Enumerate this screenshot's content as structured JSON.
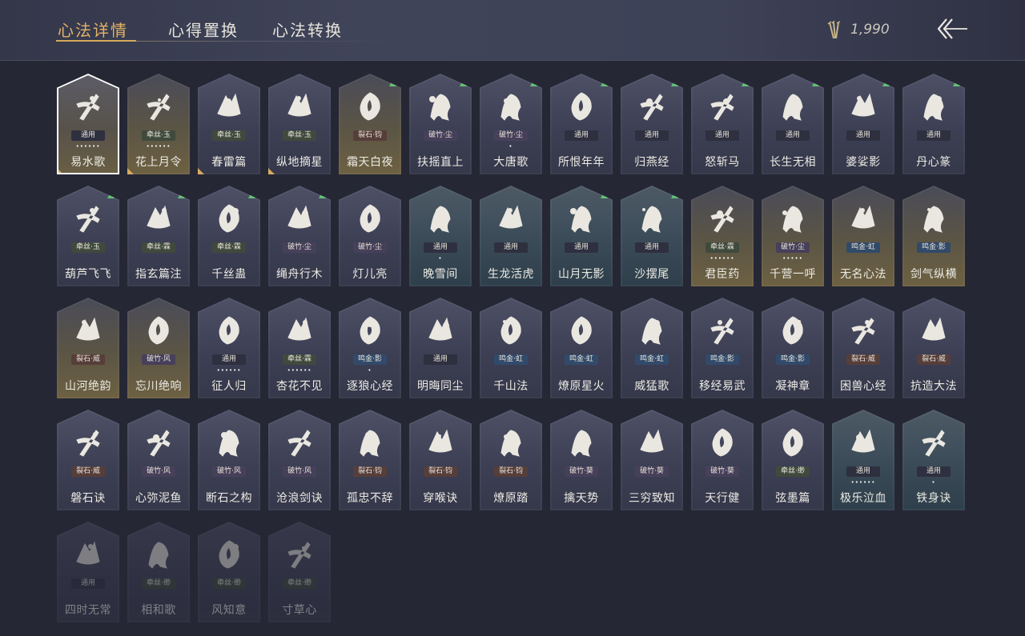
{
  "header": {
    "tabs": [
      {
        "label": "心法详情",
        "active": true
      },
      {
        "label": "心得置换",
        "active": false
      },
      {
        "label": "心法转换",
        "active": false
      }
    ],
    "currency": {
      "icon": "arrow-bundle-icon",
      "amount": "1,990"
    },
    "back_icon": "back-arrow-icon"
  },
  "colors": {
    "accent": "#e3b367",
    "upgrade_arrow": "#5fbf73",
    "background": "#262735"
  },
  "cards": [
    {
      "name": "易水歌",
      "tag": "通用",
      "tag_kind": "tongyong",
      "dots": "••••••",
      "arrow": false,
      "style": "selected",
      "icon": "horse-icon",
      "corner": true
    },
    {
      "name": "花上月令",
      "tag": "牵丝·玉",
      "tag_kind": "jinsi",
      "dots": "••••••",
      "arrow": false,
      "style": "gold",
      "icon": "flower-moon-icon",
      "corner": true
    },
    {
      "name": "春雷篇",
      "tag": "牵丝·玉",
      "tag_kind": "jinsi",
      "dots": "",
      "arrow": false,
      "style": "default",
      "icon": "thunder-tree-icon",
      "corner": true
    },
    {
      "name": "纵地摘星",
      "tag": "牵丝·玉",
      "tag_kind": "jinsi",
      "dots": "",
      "arrow": false,
      "style": "default",
      "icon": "star-grab-icon",
      "corner": true
    },
    {
      "name": "霜天白夜",
      "tag": "裂石·钧",
      "tag_kind": "jushi",
      "dots": "",
      "arrow": true,
      "style": "gold",
      "icon": "blade-icon",
      "corner": false
    },
    {
      "name": "扶摇直上",
      "tag": "破竹·尘",
      "tag_kind": "paozhu",
      "dots": "",
      "arrow": true,
      "style": "default",
      "icon": "eagle-icon",
      "corner": false
    },
    {
      "name": "大唐歌",
      "tag": "破竹·尘",
      "tag_kind": "paozhu",
      "dots": "•",
      "arrow": true,
      "style": "default",
      "icon": "palace-icon",
      "corner": false
    },
    {
      "name": "所恨年年",
      "tag": "通用",
      "tag_kind": "tongyong",
      "dots": "",
      "arrow": true,
      "style": "default",
      "icon": "ink-drop-icon",
      "corner": false
    },
    {
      "name": "归燕经",
      "tag": "通用",
      "tag_kind": "tongyong",
      "dots": "",
      "arrow": true,
      "style": "default",
      "icon": "swallow-icon",
      "corner": false
    },
    {
      "name": "怒斩马",
      "tag": "通用",
      "tag_kind": "tongyong",
      "dots": "",
      "arrow": true,
      "style": "default",
      "icon": "sabre-icon",
      "corner": false
    },
    {
      "name": "长生无相",
      "tag": "通用",
      "tag_kind": "tongyong",
      "dots": "",
      "arrow": true,
      "style": "default",
      "icon": "statue-icon",
      "corner": false
    },
    {
      "name": "婆娑影",
      "tag": "通用",
      "tag_kind": "tongyong",
      "dots": "",
      "arrow": true,
      "style": "default",
      "icon": "dragon-icon",
      "corner": false
    },
    {
      "name": "丹心篆",
      "tag": "通用",
      "tag_kind": "tongyong",
      "dots": "",
      "arrow": true,
      "style": "default",
      "icon": "fish-icon",
      "corner": false
    },
    {
      "name": "葫芦飞飞",
      "tag": "牵丝·玉",
      "tag_kind": "jinsi",
      "dots": "",
      "arrow": true,
      "style": "default",
      "icon": "gourd-icon",
      "corner": false
    },
    {
      "name": "指玄篇注",
      "tag": "牵丝·霖",
      "tag_kind": "jinsi",
      "dots": "",
      "arrow": true,
      "style": "default",
      "icon": "yinyang-icon",
      "corner": false
    },
    {
      "name": "千丝蛊",
      "tag": "牵丝·霖",
      "tag_kind": "jinsi",
      "dots": "",
      "arrow": true,
      "style": "default",
      "icon": "leaf-icon",
      "corner": false
    },
    {
      "name": "绳舟行木",
      "tag": "破竹·尘",
      "tag_kind": "paozhu",
      "dots": "",
      "arrow": true,
      "style": "default",
      "icon": "roots-icon",
      "corner": false
    },
    {
      "name": "灯儿亮",
      "tag": "破竹·尘",
      "tag_kind": "paozhu",
      "dots": "",
      "arrow": false,
      "style": "default",
      "icon": "lantern-icon",
      "corner": false
    },
    {
      "name": "晚雪间",
      "tag": "通用",
      "tag_kind": "tongyong",
      "dots": "•",
      "arrow": false,
      "style": "teal",
      "icon": "sword-cross-icon",
      "corner": false
    },
    {
      "name": "生龙活虎",
      "tag": "通用",
      "tag_kind": "tongyong",
      "dots": "",
      "arrow": false,
      "style": "teal",
      "icon": "tiger-icon",
      "corner": false
    },
    {
      "name": "山月无影",
      "tag": "通用",
      "tag_kind": "tongyong",
      "dots": "",
      "arrow": true,
      "style": "teal",
      "icon": "moon-blade-icon",
      "corner": false
    },
    {
      "name": "沙摆尾",
      "tag": "通用",
      "tag_kind": "tongyong",
      "dots": "",
      "arrow": true,
      "style": "teal",
      "icon": "whirl-icon",
      "corner": false
    },
    {
      "name": "君臣药",
      "tag": "牵丝·霖",
      "tag_kind": "jinsi",
      "dots": "••••••",
      "arrow": false,
      "style": "gold",
      "icon": "herb-icon",
      "corner": false
    },
    {
      "name": "千营一呼",
      "tag": "破竹·尘",
      "tag_kind": "paozhu",
      "dots": "•••••",
      "arrow": false,
      "style": "gold",
      "icon": "flag-icon",
      "corner": false
    },
    {
      "name": "无名心法",
      "tag": "鸣金·虹",
      "tag_kind": "mingjin",
      "dots": "",
      "arrow": false,
      "style": "gold",
      "icon": "spear-icon",
      "corner": false
    },
    {
      "name": "剑气纵横",
      "tag": "鸣金·影",
      "tag_kind": "mingjin",
      "dots": "",
      "arrow": false,
      "style": "gold",
      "icon": "crossed-swords-icon",
      "corner": false
    },
    {
      "name": "山河绝韵",
      "tag": "裂石·威",
      "tag_kind": "jushi",
      "dots": "",
      "arrow": false,
      "style": "gold",
      "icon": "mountain-icon",
      "corner": false
    },
    {
      "name": "忘川绝响",
      "tag": "破竹·风",
      "tag_kind": "paozhu",
      "dots": "",
      "arrow": false,
      "style": "gold",
      "icon": "mask-icon",
      "corner": false
    },
    {
      "name": "征人归",
      "tag": "通用",
      "tag_kind": "tongyong",
      "dots": "••••••",
      "arrow": false,
      "style": "default",
      "icon": "raven-hand-icon",
      "corner": false
    },
    {
      "name": "杏花不见",
      "tag": "牵丝·霖",
      "tag_kind": "jinsi",
      "dots": "••••••",
      "arrow": false,
      "style": "default",
      "icon": "blossom-icon",
      "corner": false
    },
    {
      "name": "逐狼心经",
      "tag": "鸣金·影",
      "tag_kind": "mingjin",
      "dots": "•",
      "arrow": false,
      "style": "default",
      "icon": "wolf-icon",
      "corner": false
    },
    {
      "name": "明晦同尘",
      "tag": "通用",
      "tag_kind": "tongyong",
      "dots": "",
      "arrow": false,
      "style": "default",
      "icon": "snake-staff-icon",
      "corner": false
    },
    {
      "name": "千山法",
      "tag": "鸣金·虹",
      "tag_kind": "mingjin",
      "dots": "",
      "arrow": false,
      "style": "default",
      "icon": "peaks-icon",
      "corner": false
    },
    {
      "name": "燎原星火",
      "tag": "鸣金·虹",
      "tag_kind": "mingjin",
      "dots": "",
      "arrow": false,
      "style": "default",
      "icon": "scythe-icon",
      "corner": false
    },
    {
      "name": "威猛歌",
      "tag": "鸣金·虹",
      "tag_kind": "mingjin",
      "dots": "",
      "arrow": false,
      "style": "default",
      "icon": "palm-icon",
      "corner": false
    },
    {
      "name": "移经易武",
      "tag": "鸣金·影",
      "tag_kind": "mingjin",
      "dots": "",
      "arrow": false,
      "style": "default",
      "icon": "monk-icon",
      "corner": false
    },
    {
      "name": "凝神章",
      "tag": "鸣金·影",
      "tag_kind": "mingjin",
      "dots": "",
      "arrow": false,
      "style": "default",
      "icon": "bow-icon",
      "corner": false
    },
    {
      "name": "困兽心经",
      "tag": "裂石·威",
      "tag_kind": "jushi",
      "dots": "",
      "arrow": false,
      "style": "default",
      "icon": "armor-icon",
      "corner": false
    },
    {
      "name": "抗造大法",
      "tag": "裂石·威",
      "tag_kind": "jushi",
      "dots": "",
      "arrow": false,
      "style": "default",
      "icon": "bell-icon",
      "corner": false
    },
    {
      "name": "磐石诀",
      "tag": "裂石·威",
      "tag_kind": "jushi",
      "dots": "",
      "arrow": false,
      "style": "default",
      "icon": "boulder-icon",
      "corner": false
    },
    {
      "name": "心弥泥鱼",
      "tag": "破竹·风",
      "tag_kind": "paozhu",
      "dots": "",
      "arrow": false,
      "style": "default",
      "icon": "rain-fish-icon",
      "corner": false
    },
    {
      "name": "断石之构",
      "tag": "破竹·风",
      "tag_kind": "paozhu",
      "dots": "",
      "arrow": false,
      "style": "default",
      "icon": "warrior-icon",
      "corner": false
    },
    {
      "name": "沧浪剑诀",
      "tag": "破竹·风",
      "tag_kind": "paozhu",
      "dots": "",
      "arrow": false,
      "style": "default",
      "icon": "serpent-icon",
      "corner": false
    },
    {
      "name": "孤忠不辞",
      "tag": "裂石·钧",
      "tag_kind": "jushi",
      "dots": "",
      "arrow": false,
      "style": "default",
      "icon": "axe-icon",
      "corner": false
    },
    {
      "name": "穿喉诀",
      "tag": "裂石·钧",
      "tag_kind": "jushi",
      "dots": "",
      "arrow": false,
      "style": "default",
      "icon": "horn-icon",
      "corner": false
    },
    {
      "name": "燎原踏",
      "tag": "裂石·钧",
      "tag_kind": "jushi",
      "dots": "",
      "arrow": false,
      "style": "default",
      "icon": "rearing-horse-icon",
      "corner": false
    },
    {
      "name": "擒天势",
      "tag": "破竹·葵",
      "tag_kind": "paozhu",
      "dots": "",
      "arrow": false,
      "style": "default",
      "icon": "chain-fist-icon",
      "corner": false
    },
    {
      "name": "三穷致知",
      "tag": "破竹·葵",
      "tag_kind": "paozhu",
      "dots": "",
      "arrow": false,
      "style": "default",
      "icon": "scroll-icon",
      "corner": false
    },
    {
      "name": "天行健",
      "tag": "破竹·葵",
      "tag_kind": "paozhu",
      "dots": "",
      "arrow": false,
      "style": "default",
      "icon": "hat-rain-icon",
      "corner": false
    },
    {
      "name": "弦墨篇",
      "tag": "牵丝·缈",
      "tag_kind": "jinsi",
      "dots": "",
      "arrow": false,
      "style": "default",
      "icon": "flute-icon",
      "corner": false
    },
    {
      "name": "极乐泣血",
      "tag": "通用",
      "tag_kind": "tongyong",
      "dots": "••••••",
      "arrow": false,
      "style": "teal",
      "icon": "crescent-icon",
      "corner": false
    },
    {
      "name": "铁身诀",
      "tag": "通用",
      "tag_kind": "tongyong",
      "dots": "•",
      "arrow": false,
      "style": "teal",
      "icon": "muscle-icon",
      "corner": false
    },
    {
      "name": "四时无常",
      "tag": "通用",
      "tag_kind": "tongyong",
      "dots": "",
      "arrow": false,
      "style": "dim",
      "icon": "dragon-coil-icon",
      "corner": false
    },
    {
      "name": "相和歌",
      "tag": "牵丝·缈",
      "tag_kind": "jinsi",
      "dots": "",
      "arrow": false,
      "style": "dim",
      "icon": "serpent-knot-icon",
      "corner": false
    },
    {
      "name": "风知意",
      "tag": "牵丝·缈",
      "tag_kind": "jinsi",
      "dots": "",
      "arrow": false,
      "style": "dim",
      "icon": "crab-icon",
      "corner": false
    },
    {
      "name": "寸草心",
      "tag": "牵丝·缈",
      "tag_kind": "jinsi",
      "dots": "",
      "arrow": false,
      "style": "dim",
      "icon": "sprout-icon",
      "corner": false
    }
  ]
}
